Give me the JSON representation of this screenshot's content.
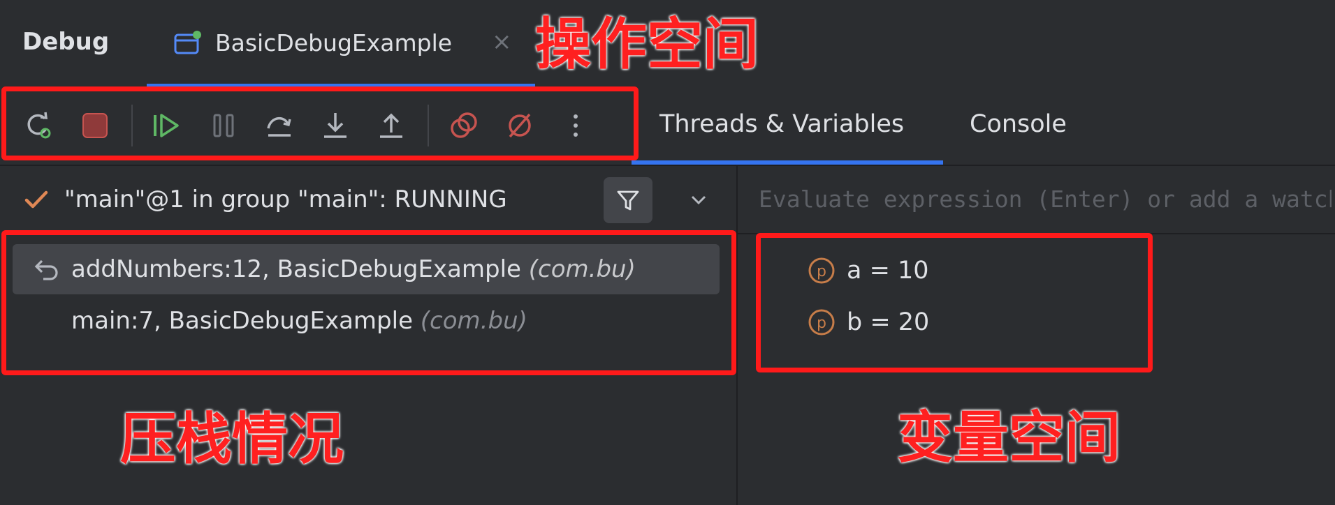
{
  "header": {
    "title": "Debug",
    "tab_label": "BasicDebugExample",
    "tab_close": "×"
  },
  "annotations": {
    "operation_space": "操作空间",
    "stack_status": "压栈情况",
    "variable_space": "变量空间"
  },
  "toolbar": {
    "buttons": [
      {
        "name": "rerun",
        "icon": "rerun-icon"
      },
      {
        "name": "stop",
        "icon": "stop-icon"
      },
      {
        "name": "resume",
        "icon": "resume-icon"
      },
      {
        "name": "pause",
        "icon": "pause-icon"
      },
      {
        "name": "step-over",
        "icon": "step-over-icon"
      },
      {
        "name": "step-into",
        "icon": "step-into-icon"
      },
      {
        "name": "step-out",
        "icon": "step-out-icon"
      },
      {
        "name": "view-breakpoints",
        "icon": "breakpoints-icon"
      },
      {
        "name": "mute-breakpoints",
        "icon": "mute-breakpoints-icon"
      },
      {
        "name": "more",
        "icon": "more-vertical-icon"
      }
    ]
  },
  "view_tabs": [
    {
      "label": "Threads & Variables",
      "active": true
    },
    {
      "label": "Console",
      "active": false
    }
  ],
  "threads": {
    "current_thread": "\"main\"@1 in group \"main\": RUNNING"
  },
  "frames": [
    {
      "method": "addNumbers:12, BasicDebugExample ",
      "package": "(com.bu)",
      "selected": true
    },
    {
      "method": "main:7, BasicDebugExample ",
      "package": "(com.bu)",
      "selected": false
    }
  ],
  "evaluate": {
    "placeholder": "Evaluate expression (Enter) or add a watch (Ctrl+Shift+Enter)"
  },
  "variables": [
    {
      "badge": "p",
      "text": "a = 10"
    },
    {
      "badge": "p",
      "text": "b = 20"
    }
  ],
  "colors": {
    "accent": "#3574f0",
    "annotation_red": "#ff1a1a",
    "param_badge": "#c77d49",
    "resume_green": "#5fb865",
    "stop_red": "#c75450"
  }
}
